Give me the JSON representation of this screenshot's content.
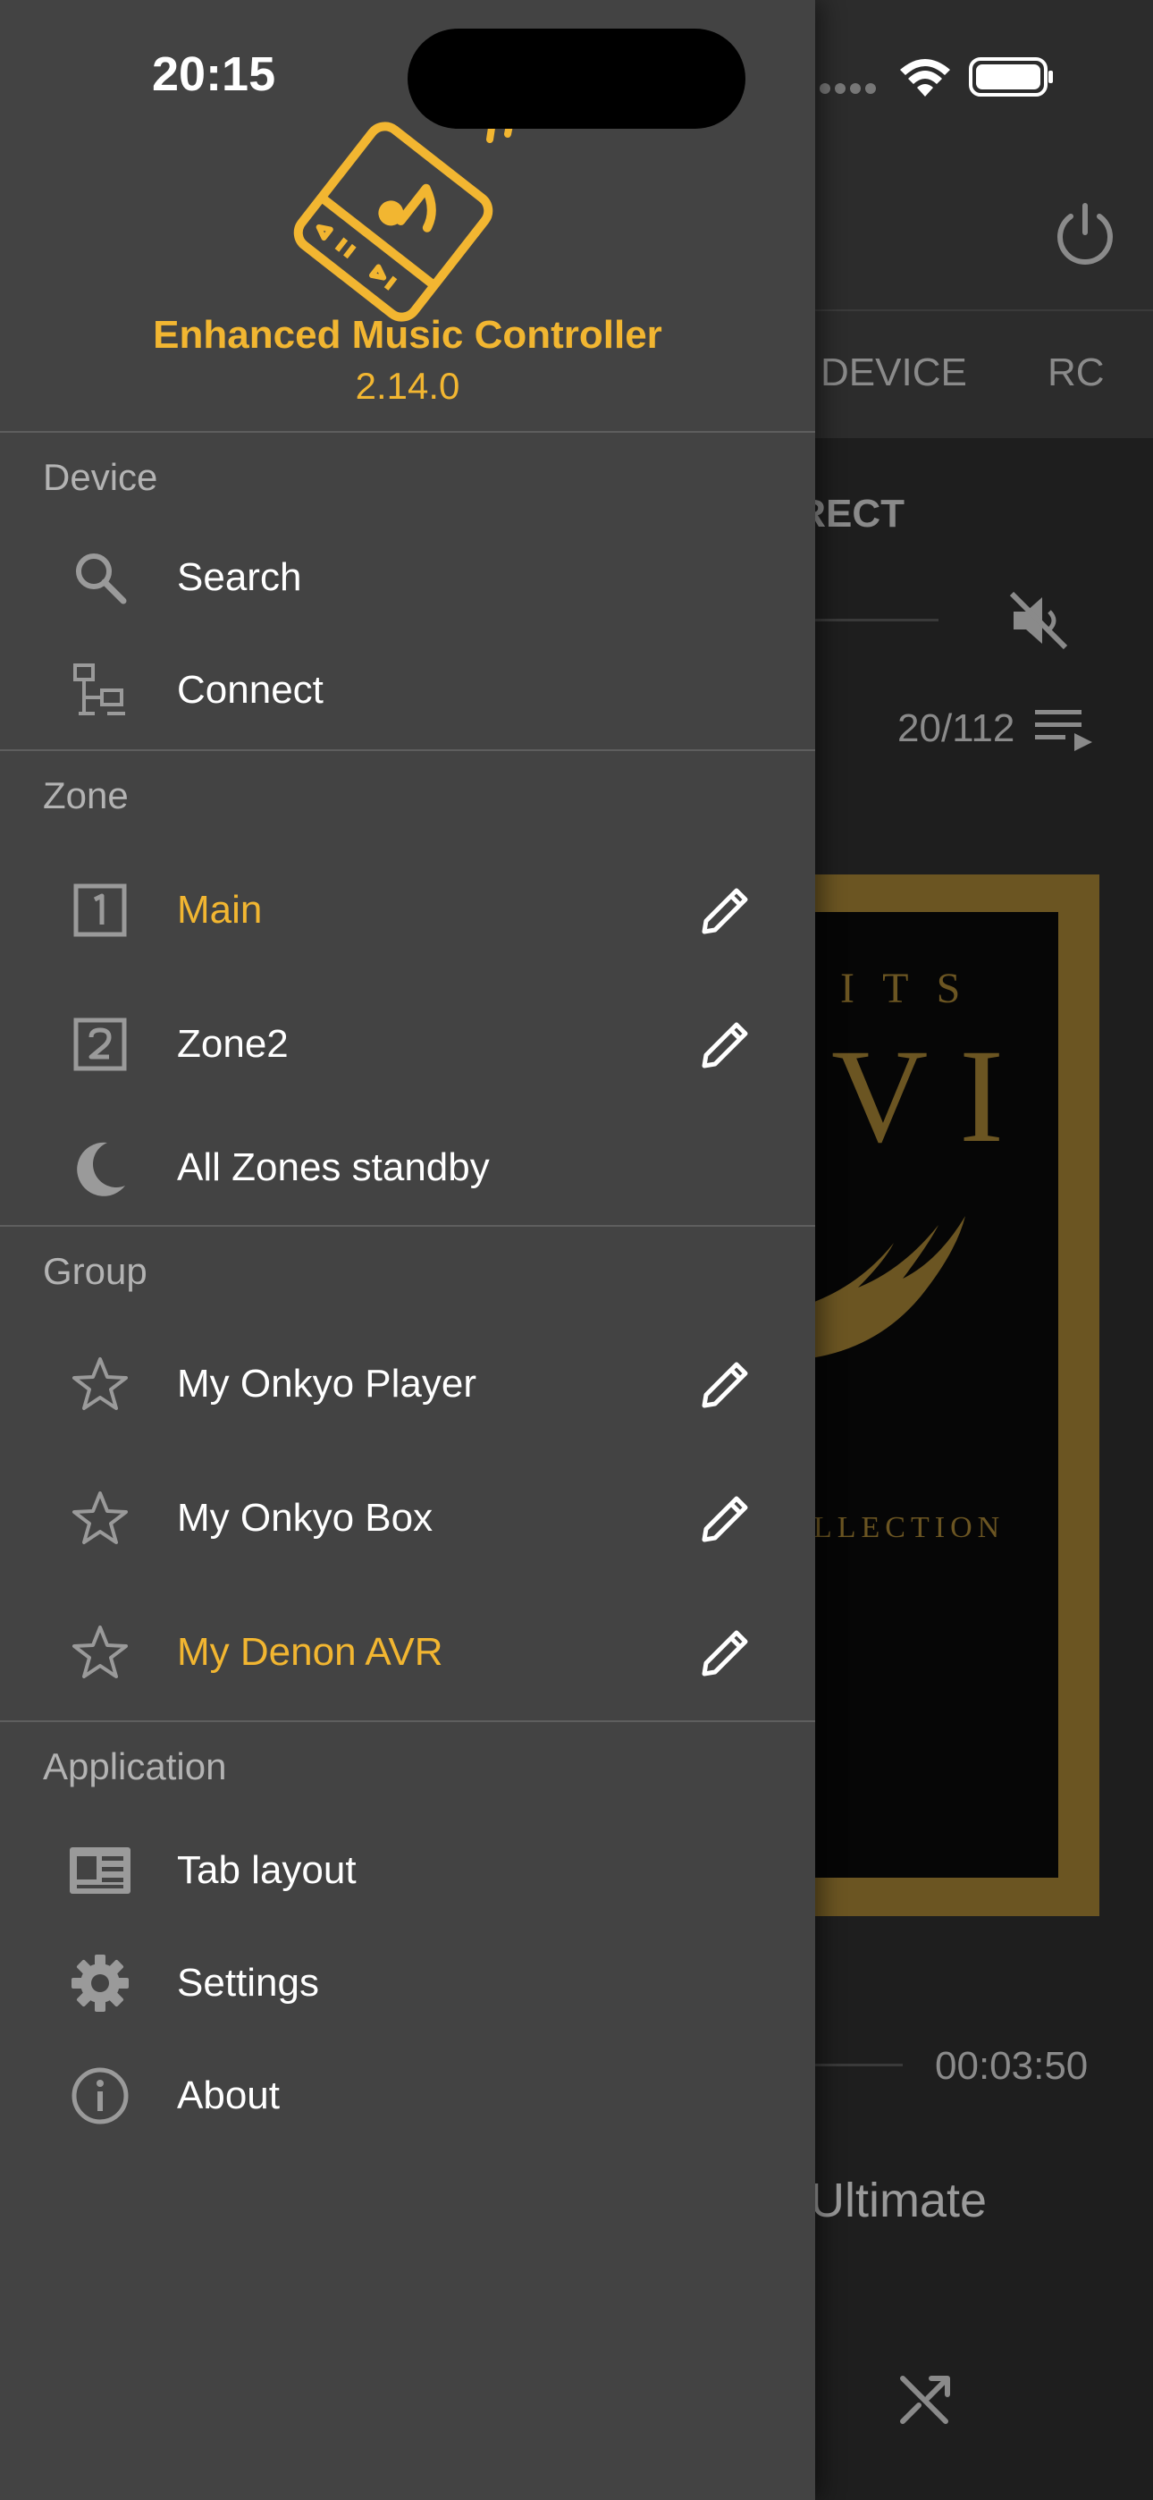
{
  "status_bar": {
    "time": "20:15"
  },
  "background": {
    "tab_device": "DEVICE",
    "tab_rc": "RC",
    "input_label": "IRECT",
    "track_counter": "20/112",
    "time_total": "00:03:50",
    "album_title": "Ultimate",
    "cover_text_top": "I T S",
    "cover_numeral": "V I",
    "cover_text_bottom": "LLECTION"
  },
  "drawer": {
    "app_name": "Enhanced Music Controller",
    "version": "2.14.0",
    "sections": {
      "device": {
        "title": "Device",
        "items": [
          {
            "label": "Search",
            "icon": "search-icon"
          },
          {
            "label": "Connect",
            "icon": "network-icon"
          }
        ]
      },
      "zone": {
        "title": "Zone",
        "items": [
          {
            "label": "Main",
            "icon": "zone-1-icon",
            "active": true
          },
          {
            "label": "Zone2",
            "icon": "zone-2-icon",
            "active": false
          },
          {
            "label": "All Zones standby",
            "icon": "moon-icon"
          }
        ]
      },
      "group": {
        "title": "Group",
        "items": [
          {
            "label": "My Onkyo Player",
            "icon": "star-outline-icon",
            "active": false
          },
          {
            "label": "My Onkyo Box",
            "icon": "star-outline-icon",
            "active": false
          },
          {
            "label": "My Denon AVR",
            "icon": "star-outline-icon",
            "active": true
          }
        ]
      },
      "application": {
        "title": "Application",
        "items": [
          {
            "label": "Tab layout",
            "icon": "tab-layout-icon"
          },
          {
            "label": "Settings",
            "icon": "gear-icon"
          },
          {
            "label": "About",
            "icon": "info-icon"
          }
        ]
      }
    }
  },
  "colors": {
    "accent": "#f2b631",
    "drawer_bg": "#434343",
    "text": "#ffffff",
    "section_title": "#b3b3b3"
  }
}
